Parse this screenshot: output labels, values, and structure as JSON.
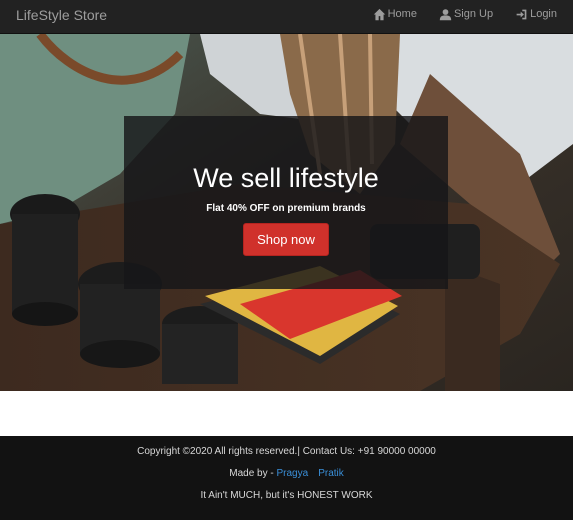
{
  "navbar": {
    "brand": "LifeStyle Store",
    "links": [
      {
        "label": "Home",
        "icon": "home-icon"
      },
      {
        "label": "Sign Up",
        "icon": "user-icon"
      },
      {
        "label": "Login",
        "icon": "login-icon"
      }
    ]
  },
  "hero": {
    "title": "We sell lifestyle",
    "subtitle": "Flat 40% OFF on premium brands",
    "button_label": "Shop now",
    "button_color": "#d0312b"
  },
  "footer": {
    "copyright": "Copyright ©2020 All rights reserved.| Contact Us: +91 90000 00000",
    "made_by_prefix": "Made by - ",
    "authors": [
      "Pragya",
      "Pratik"
    ],
    "tagline": "It Ain't MUCH, but it's HONEST WORK",
    "link_color": "#3a8fd8"
  }
}
